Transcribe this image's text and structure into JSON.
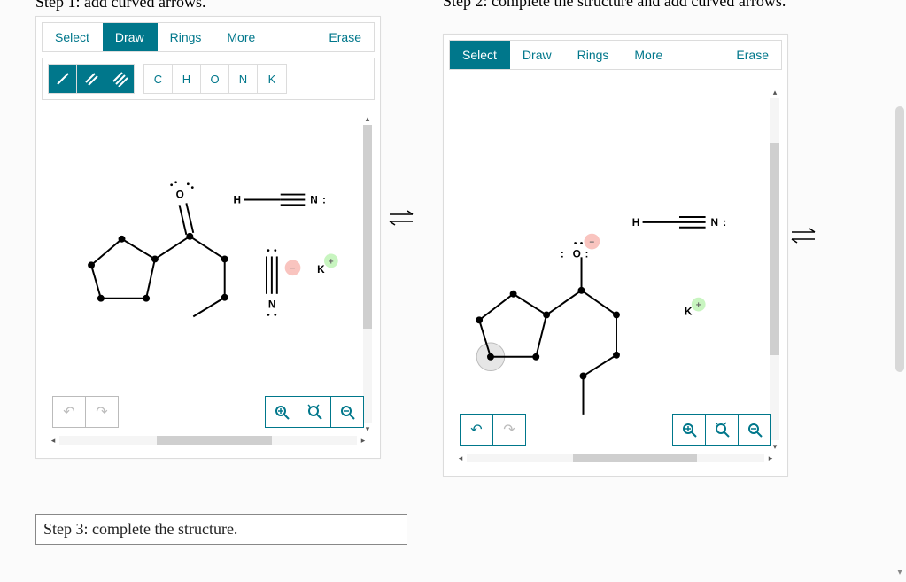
{
  "step1_title": "Step 1: add curved arrows.",
  "step2_title": "Step 2: complete the structure and add curved arrows.",
  "step3_title": "Step 3: complete the structure.",
  "toolbar": {
    "select": "Select",
    "draw": "Draw",
    "rings": "Rings",
    "more": "More",
    "erase": "Erase"
  },
  "atoms": {
    "c": "C",
    "h": "H",
    "o": "O",
    "n": "N",
    "k": "K"
  },
  "labels": {
    "O": "O",
    "H": "H",
    "N": "N",
    "K": "K",
    "colon": ":"
  },
  "panel1": {
    "active_tab": "draw"
  },
  "panel2": {
    "active_tab": "select"
  }
}
